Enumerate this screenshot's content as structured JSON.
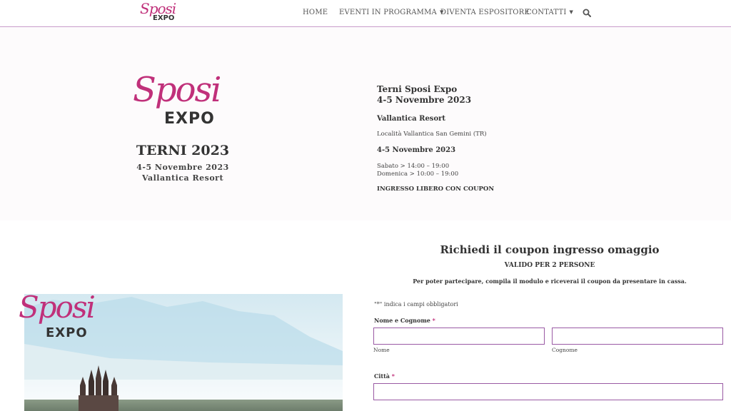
{
  "header": {
    "logo_script": "Sposi",
    "logo_expo": "EXPO",
    "nav": [
      {
        "label": "HOME",
        "has_dropdown": false
      },
      {
        "label": "EVENTI IN PROGRAMMA",
        "has_dropdown": true
      },
      {
        "label": "DIVENTA ESPOSITORE",
        "has_dropdown": false
      },
      {
        "label": "CONTATTI",
        "has_dropdown": true
      }
    ],
    "search_icon": "search-icon",
    "chevron_icon": "chevron-down-icon"
  },
  "hero": {
    "logo_script": "Sposi",
    "logo_expo": "EXPO",
    "title": "TERNI 2023",
    "dates": "4-5 Novembre 2023",
    "venue": "Vallantica Resort",
    "info": {
      "heading_line1": "Terni Sposi Expo",
      "heading_line2": "4-5 Novembre 2023",
      "venue": "Vallantica Resort",
      "address": "Località Vallantica San Gemini (TR)",
      "dates": "4-5 Novembre 2023",
      "hours_line1": "Sabato > 14:00 – 19:00",
      "hours_line2": "Domenica > 10:00 – 19:00",
      "entry": "INGRESSO LIBERO CON COUPON"
    }
  },
  "promo": {
    "logo_script": "Sposi",
    "logo_expo": "EXPO"
  },
  "form": {
    "title": "Richiedi il coupon ingresso omaggio",
    "valid": "VALIDO PER 2 PERSONE",
    "description": "Per poter partecipare, compila il modulo e riceverai il coupon da presentare in cassa.",
    "required_note": "\"*\" indica i campi obbligatori",
    "name_label": "Nome e Cognome",
    "required_mark": "*",
    "first_name_value": "",
    "first_name_sublabel": "Nome",
    "last_name_value": "",
    "last_name_sublabel": "Cognome",
    "city_label": "Città",
    "city_value": ""
  },
  "colors": {
    "brand_pink": "#c0307a",
    "input_border": "#9a5aa4",
    "header_border": "#c79ac9"
  }
}
